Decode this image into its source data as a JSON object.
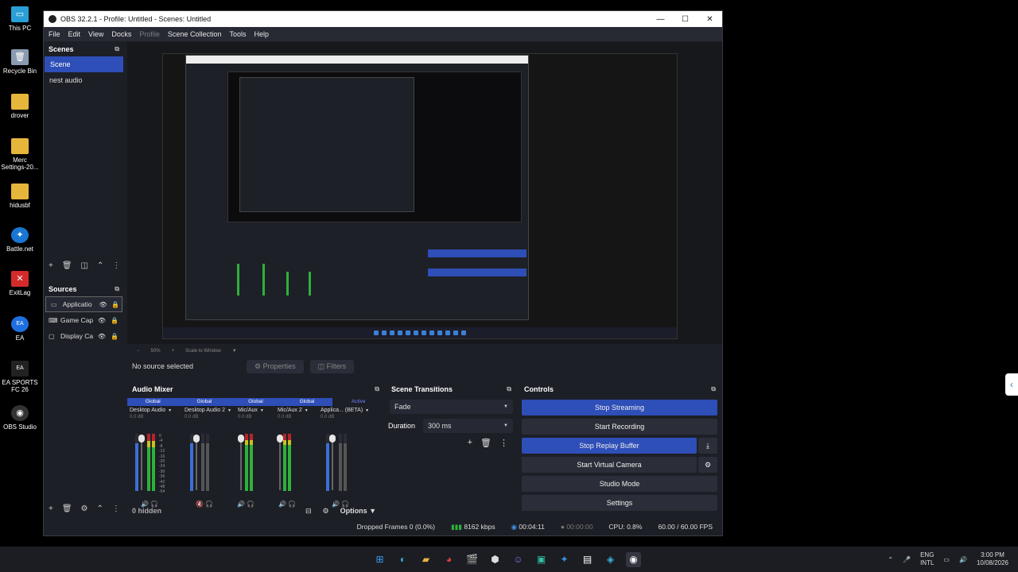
{
  "desktop": {
    "icons": [
      {
        "label": "This PC"
      },
      {
        "label": "Recycle Bin"
      },
      {
        "label": "drover"
      },
      {
        "label": "Merc Settings-20..."
      },
      {
        "label": "hidusbf"
      },
      {
        "label": "Battle.net"
      },
      {
        "label": "ExitLag"
      },
      {
        "label": "EA"
      },
      {
        "label": "EA SPORTS FC 26"
      },
      {
        "label": "OBS Studio"
      }
    ]
  },
  "window": {
    "title": "OBS 32.2.1 - Profile: Untitled - Scenes: Untitled",
    "controls": {
      "minimize": "—",
      "maximize": "☐",
      "close": "✕"
    }
  },
  "menu": {
    "file": "File",
    "edit": "Edit",
    "view": "View",
    "docks": "Docks",
    "profile": "Profile",
    "scene_collection": "Scene Collection",
    "tools": "Tools",
    "help": "Help"
  },
  "scenes": {
    "title": "Scenes",
    "items": [
      {
        "label": "Scene"
      },
      {
        "label": "nest audio"
      }
    ]
  },
  "sources": {
    "title": "Sources",
    "items": [
      {
        "label": "Applicatio"
      },
      {
        "label": "Game Cap"
      },
      {
        "label": "Display Ca"
      }
    ],
    "hidden_label": "0 hidden"
  },
  "preview": {
    "zoom": "50%",
    "scale_mode": "Scale to Window"
  },
  "source_bar": {
    "no_source": "No source selected",
    "properties": "Properties",
    "filters": "Filters"
  },
  "audio_mixer": {
    "title": "Audio Mixer",
    "heads": [
      "Global",
      "Global",
      "Global",
      "Global",
      "Active"
    ],
    "channels": [
      {
        "name": "Desktop Audio",
        "db": "0.0 dB"
      },
      {
        "name": "Desktop Audio 2",
        "db": "0.0 dB"
      },
      {
        "name": "Mic/Aux",
        "db": "0.0 dB"
      },
      {
        "name": "Mic/Aux 2",
        "db": "0.0 dB"
      },
      {
        "name": "Applica... (BETA)",
        "db": "0.0 dB"
      }
    ],
    "scale": [
      "0",
      "-4",
      "-8",
      "-12",
      "-16",
      "-20",
      "-24",
      "-30",
      "-36",
      "-42",
      "-48",
      "-54",
      "-60"
    ],
    "options": "Options"
  },
  "transitions": {
    "title": "Scene Transitions",
    "selected": "Fade",
    "duration_label": "Duration",
    "duration_value": "300 ms"
  },
  "controls": {
    "title": "Controls",
    "stop_streaming": "Stop Streaming",
    "start_recording": "Start Recording",
    "stop_replay": "Stop Replay Buffer",
    "start_virtual_camera": "Start Virtual Camera",
    "studio_mode": "Studio Mode",
    "settings": "Settings"
  },
  "status": {
    "dropped": "Dropped Frames 0 (0.0%)",
    "bitrate": "8162 kbps",
    "stream_time": "00:04:11",
    "record_time": "00:00:00",
    "cpu": "CPU: 0.8%",
    "fps": "60.00 / 60.00 FPS"
  },
  "taskbar": {
    "lang_1": "ENG",
    "lang_2": "INTL",
    "time": "3:00 PM",
    "date": "10/08/2026"
  },
  "colors": {
    "accent": "#2e4eb8",
    "meter_green": "#2fb03a",
    "meter_red": "#b4242c"
  }
}
